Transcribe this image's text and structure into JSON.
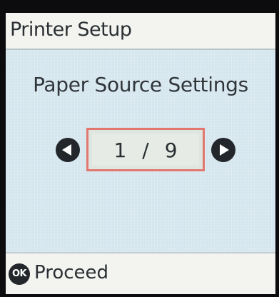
{
  "header": {
    "title": "Printer Setup"
  },
  "main": {
    "heading": "Paper Source Settings",
    "pager": {
      "current": "1",
      "separator": "/",
      "total": "9"
    }
  },
  "footer": {
    "ok_icon_text": "OK",
    "proceed_label": "Proceed"
  },
  "icons": {
    "prev": "triangle-left-icon",
    "next": "triangle-right-icon",
    "ok": "ok-button-icon"
  },
  "colors": {
    "screen_bg": "#d5e6ee",
    "bar_bg": "#f3f4f0",
    "highlight_border": "#e2776e",
    "text": "#2a2f33"
  }
}
